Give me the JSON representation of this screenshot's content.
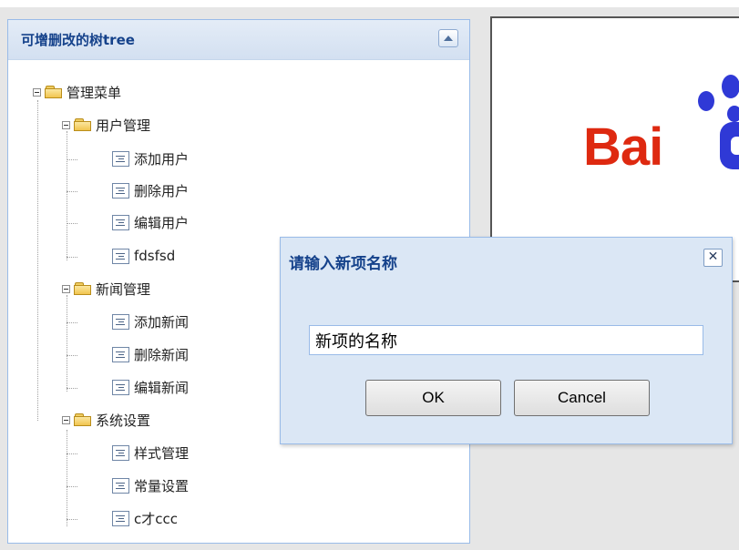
{
  "panel": {
    "title": "可增删改的树tree"
  },
  "tree": {
    "root": "管理菜单",
    "groups": [
      {
        "label": "用户管理",
        "items": [
          "添加用户",
          "删除用户",
          "编辑用户",
          "fdsfsd"
        ]
      },
      {
        "label": "新闻管理",
        "items": [
          "添加新闻",
          "删除新闻",
          "编辑新闻"
        ]
      },
      {
        "label": "系统设置",
        "items": [
          "样式管理",
          "常量设置",
          "c才ccc"
        ]
      }
    ]
  },
  "content": {
    "logo_text": "Bai"
  },
  "dialog": {
    "title": "请输入新项名称",
    "close_glyph": "✕",
    "input_value": "新项的名称",
    "ok_label": "OK",
    "cancel_label": "Cancel"
  },
  "colors": {
    "header_text": "#15428b",
    "panel_border": "#99bbe8",
    "logo_red": "#de2910",
    "logo_blue": "#2f39d6"
  }
}
